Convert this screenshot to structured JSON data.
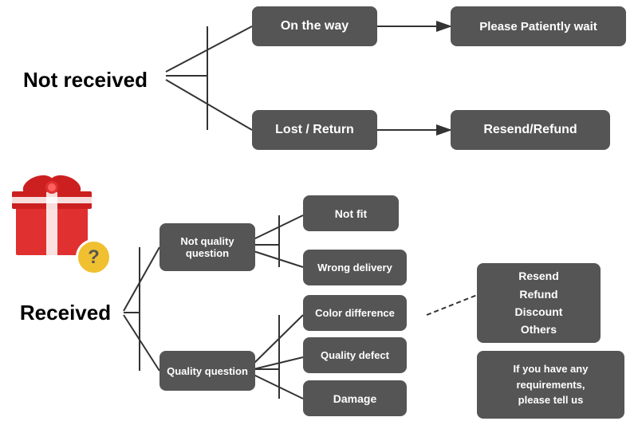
{
  "nodes": {
    "not_received": {
      "label": "Not received"
    },
    "received": {
      "label": "Received"
    },
    "on_the_way": {
      "label": "On the way"
    },
    "lost_return": {
      "label": "Lost / Return"
    },
    "please_wait": {
      "label": "Please Patiently wait"
    },
    "resend_refund_1": {
      "label": "Resend/Refund"
    },
    "not_quality": {
      "label": "Not quality\nquestion"
    },
    "quality_question": {
      "label": "Quality question"
    },
    "not_fit": {
      "label": "Not fit"
    },
    "wrong_delivery": {
      "label": "Wrong delivery"
    },
    "color_difference": {
      "label": "Color difference"
    },
    "quality_defect": {
      "label": "Quality defect"
    },
    "damage": {
      "label": "Damage"
    },
    "resend_refund_2": {
      "label": "Resend\nRefund\nDiscount\nOthers"
    },
    "requirements": {
      "label": "If you have any\nrequirements,\nplease tell us"
    }
  },
  "icon": {
    "question_mark": "?"
  }
}
